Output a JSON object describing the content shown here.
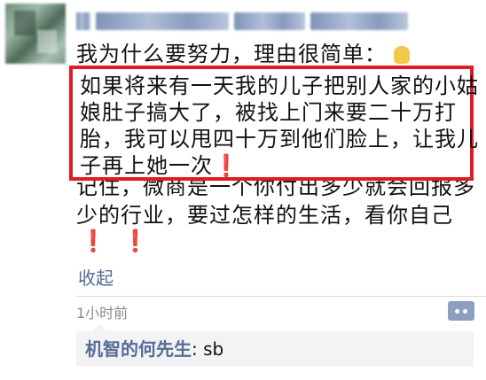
{
  "post": {
    "avatar_icon": "blurred-avatar-icon",
    "line1": "我为什么要努力，理由很简单：",
    "highlight_lines": [
      "如果将来有一天我的儿子把别人家的小姑",
      "娘肚子搞大了，被找上门来要二十万打",
      "胎，我可以甩四十万到他们脸上，让我儿",
      "子再上她一次"
    ],
    "exclaim": "❗",
    "line_after_1": "记住，微商是一个你付出多少就会回报多",
    "line_after_2": "少的行业，要过怎样的生活，看你自己",
    "exclaims": "❗❗",
    "collapse_label": "收起",
    "time": "1小时前"
  },
  "comment": {
    "author": "机智的何先生",
    "separator": ": ",
    "text": "sb"
  },
  "colors": {
    "highlight_border": "#e01b24",
    "link_blue": "#576b95",
    "exclaim_red": "#d81e22"
  },
  "icons": {
    "praise_icon": "hand-emoji-icon",
    "comment_icon": "comment-dots-icon"
  }
}
